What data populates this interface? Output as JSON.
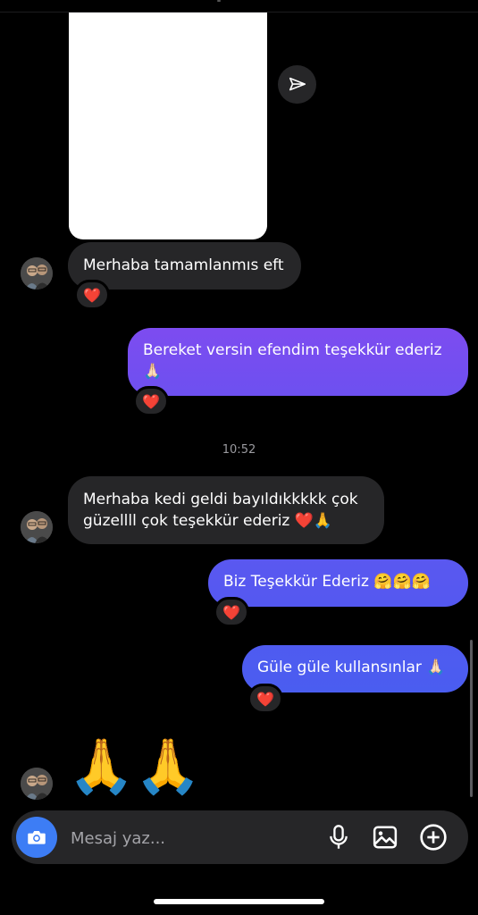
{
  "colors": {
    "background": "#000000",
    "incoming_bubble": "#262628",
    "outgoing_gradient_top": "#7d4cf0",
    "outgoing_gradient_bottom": "#4a5df0",
    "accent_blue": "#3d7df5",
    "heart": "#e0263d"
  },
  "messages": [
    {
      "direction": "incoming",
      "text": "Merhaba tamamlanmıs eft",
      "reaction": "❤️"
    },
    {
      "direction": "outgoing",
      "text": "Bereket versin efendim teşekkür ederiz 🙏🏻",
      "reaction": "❤️"
    },
    {
      "direction": "timestamp",
      "text": "10:52"
    },
    {
      "direction": "incoming",
      "text": "Merhaba kedi geldi bayıldıkkkkk çok güzellll çok teşekkür ederiz ❤️🙏",
      "reaction": ""
    },
    {
      "direction": "outgoing",
      "text": "Biz Teşekkür Ederiz 🤗🤗🤗",
      "reaction": "❤️"
    },
    {
      "direction": "outgoing",
      "text": "Güle güle kullansınlar 🙏🏻",
      "reaction": "❤️"
    },
    {
      "direction": "incoming",
      "text": "🙏🙏",
      "reaction": ""
    }
  ],
  "composer": {
    "placeholder": "Mesaj yaz...",
    "icons": [
      "camera-icon",
      "microphone-icon",
      "gallery-icon",
      "add-icon"
    ]
  },
  "icons": {
    "share": "send-icon",
    "reaction": "heart-icon"
  }
}
